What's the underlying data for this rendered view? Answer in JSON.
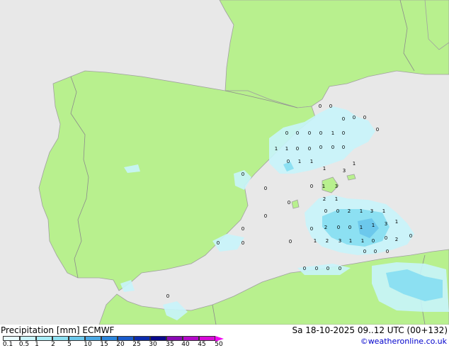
{
  "footer": {
    "title_left": "Precipitation [mm] ECMWF",
    "title_right": "Sa 18-10-2025 09..12 UTC (00+132)",
    "credit": "©weatheronline.co.uk"
  },
  "legend": {
    "labels": [
      "0.1",
      "0.5",
      "1",
      "2",
      "5",
      "10",
      "15",
      "20",
      "25",
      "30",
      "35",
      "40",
      "45",
      "50"
    ],
    "colors": [
      "#e8fbff",
      "#c8f4fb",
      "#a8edf8",
      "#8ce0f2",
      "#6cc8ec",
      "#4aa8e4",
      "#2c86dc",
      "#1a5ccc",
      "#0c2cae",
      "#0a0a8c",
      "#8a0ab4",
      "#b40ac8",
      "#d80ad8",
      "#f00af0"
    ]
  },
  "map": {
    "colors": {
      "sea": "#e8e8e8",
      "land": "#b8f08e",
      "coast": "#a0a0a0",
      "border": "#8c8c8c",
      "precip_light": "#c8f4fb",
      "precip_mid": "#8ce0f2",
      "precip_heavy": "#6cc8ec"
    },
    "values": [
      "0",
      "0",
      "0",
      "0",
      "0",
      "0",
      "1",
      "0",
      "0",
      "0",
      "0",
      "1",
      "0",
      "1",
      "0",
      "0",
      "0",
      "0",
      "0",
      "0",
      "1",
      "1",
      "1",
      "3",
      "1",
      "0",
      "1",
      "3",
      "2",
      "1",
      "0",
      "0",
      "2",
      "1",
      "3",
      "1",
      "1",
      "0",
      "2",
      "0",
      "0",
      "1",
      "1",
      "3",
      "1",
      "2",
      "3",
      "1",
      "1",
      "0",
      "0",
      "2",
      "0",
      "0",
      "0",
      "0",
      "0",
      "0",
      "0",
      "0",
      "0",
      "0",
      "0",
      "0",
      "0",
      "0",
      "0",
      "0",
      "0"
    ]
  }
}
